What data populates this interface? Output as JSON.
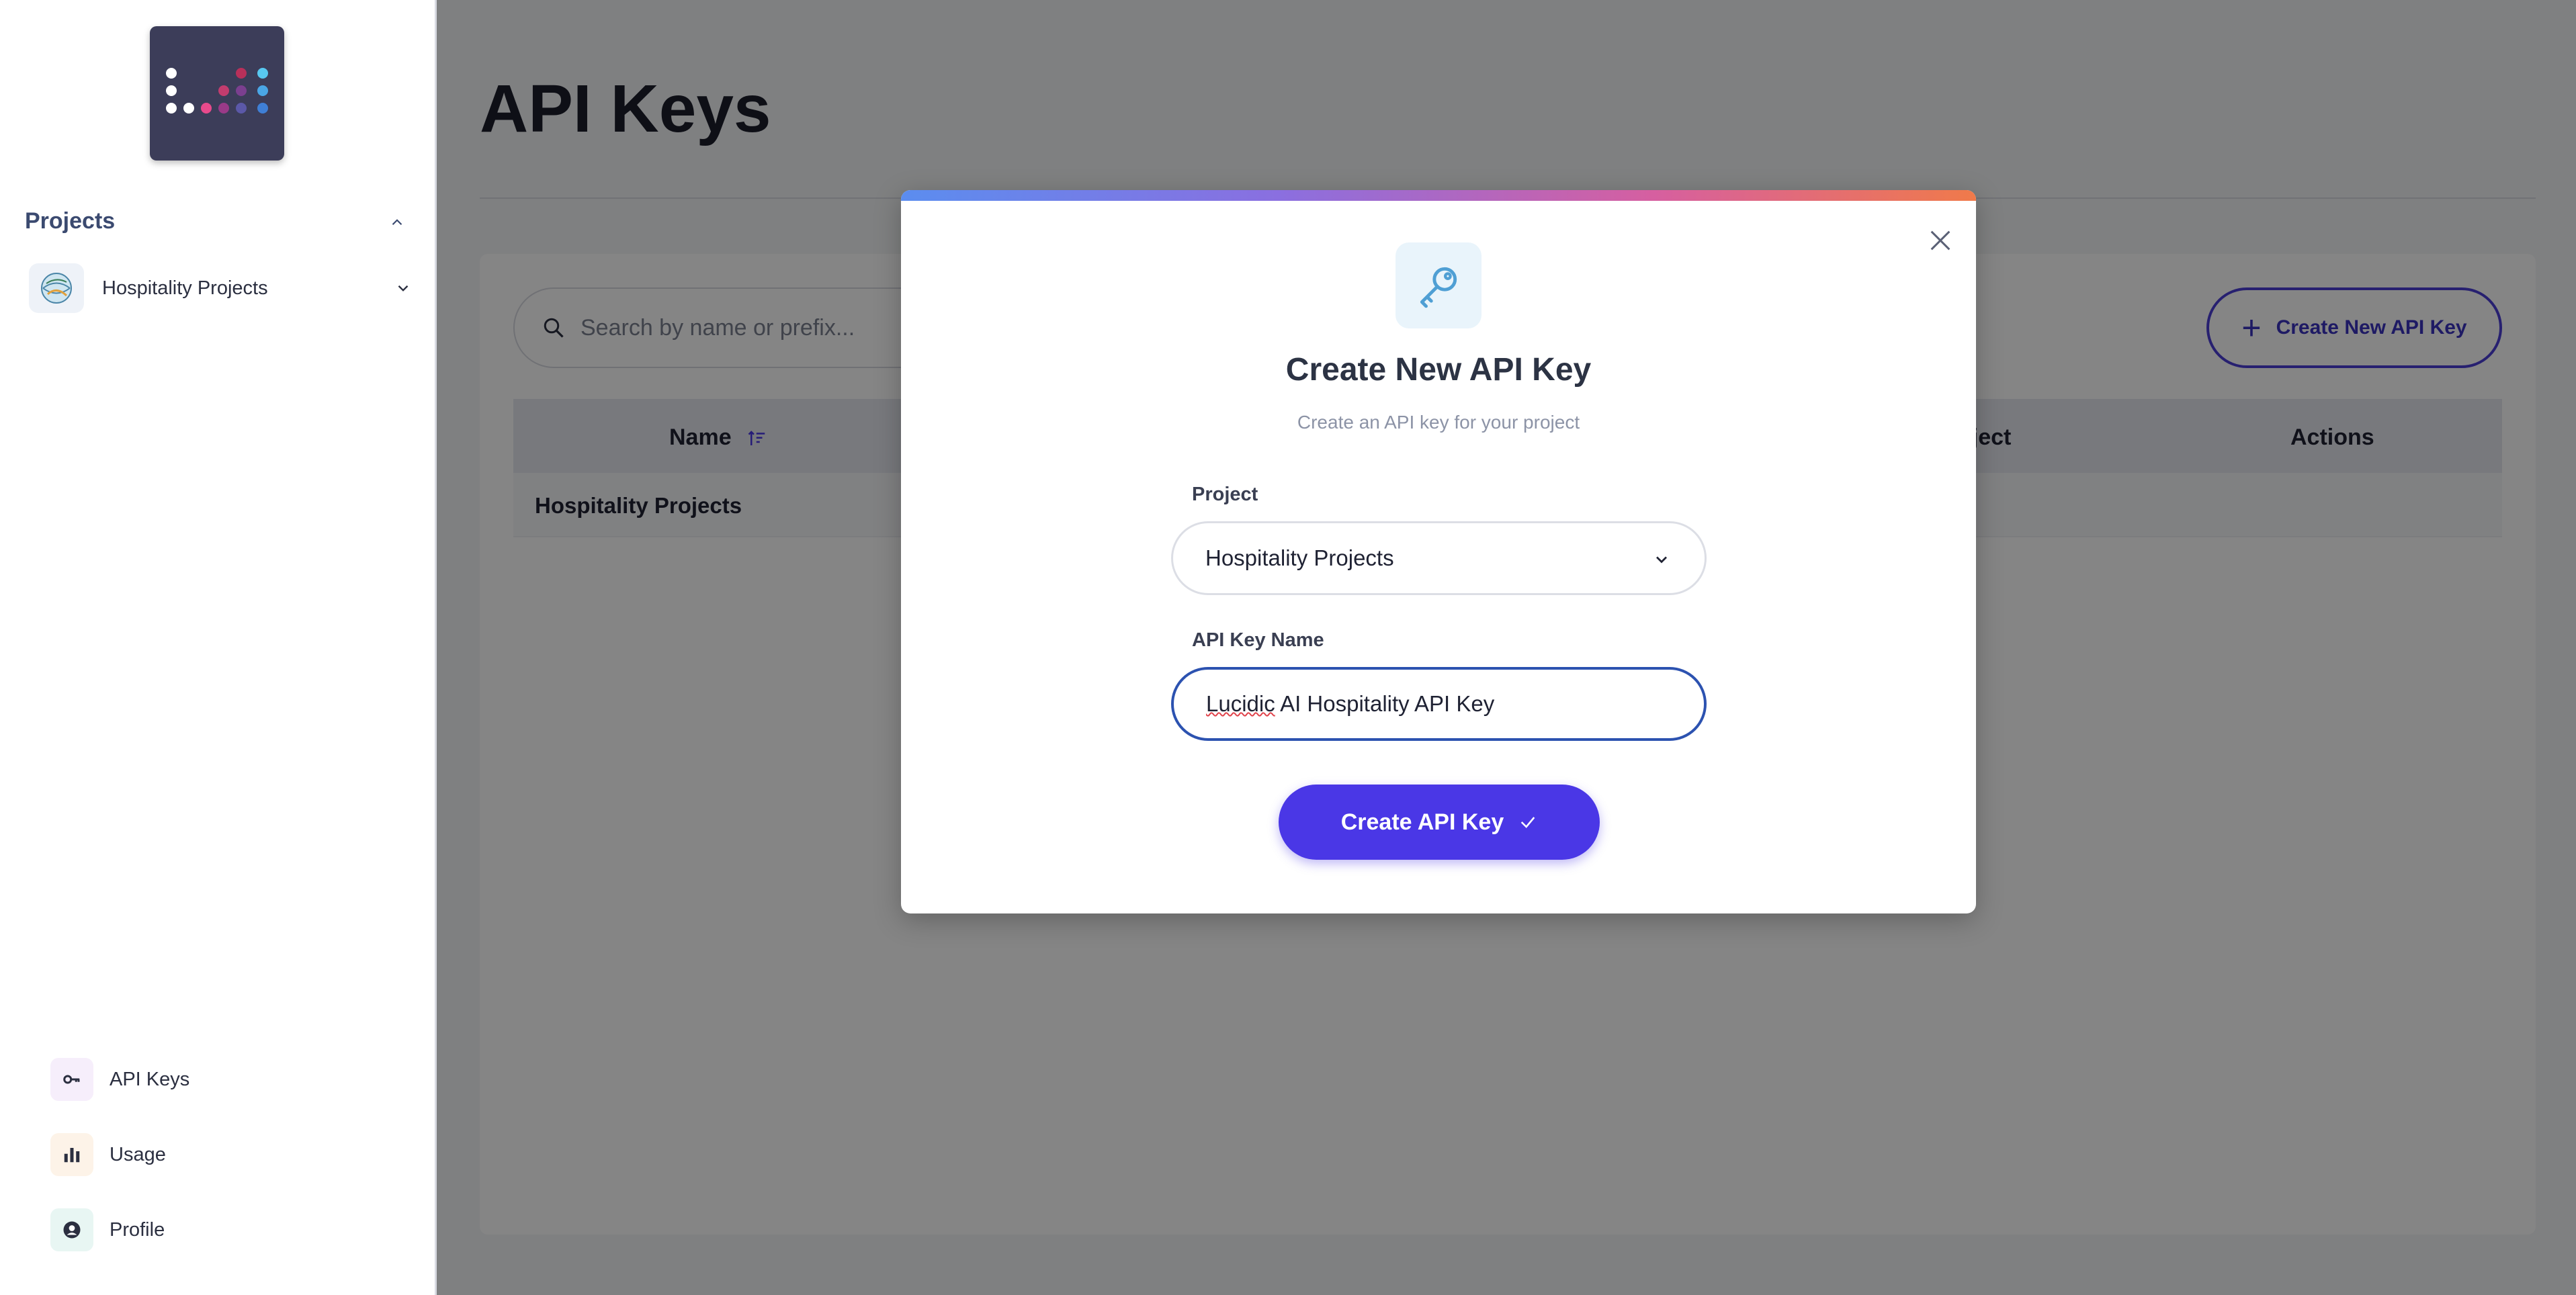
{
  "sidebar": {
    "projects_heading": "Projects",
    "selected_project": "Hospitality Projects",
    "nav": [
      {
        "label": "API Keys",
        "icon": "key-icon"
      },
      {
        "label": "Usage",
        "icon": "bar-chart-icon"
      },
      {
        "label": "Profile",
        "icon": "user-icon"
      }
    ]
  },
  "main": {
    "title": "API Keys",
    "search": {
      "placeholder": "Search by name or prefix..."
    },
    "create_button_label": "Create New API Key",
    "table": {
      "headers": {
        "name": "Name",
        "project": "oject",
        "actions": "Actions"
      },
      "rows": [
        {
          "name": "Hospitality Projects"
        }
      ]
    }
  },
  "modal": {
    "title": "Create New API Key",
    "subtitle": "Create an API key for your project",
    "project_label": "Project",
    "project_value": "Hospitality Projects",
    "name_label": "API Key Name",
    "name_value_misspelled": "Lucidic",
    "name_value_rest": " AI Hospitality API Key",
    "submit_label": "Create API Key"
  },
  "colors": {
    "primary": "#4a37e6",
    "input_focus": "#2c52b0",
    "sidebar_logo_bg": "#3c3d59"
  }
}
